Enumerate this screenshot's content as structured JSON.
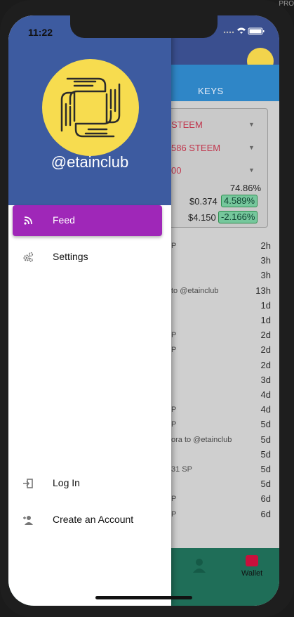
{
  "status": {
    "time": "11:22",
    "corner_text": "PRO"
  },
  "drawer": {
    "username": "@etainclub",
    "menu": [
      {
        "label": "Feed",
        "icon": "rss-icon",
        "active": true
      },
      {
        "label": "Settings",
        "icon": "gears-icon",
        "active": false
      }
    ],
    "bottom_menu": [
      {
        "label": "Log In",
        "icon": "login-icon"
      },
      {
        "label": "Create an Account",
        "icon": "add-user-icon"
      }
    ]
  },
  "background_app": {
    "tab_label": "KEYS",
    "dropdowns": [
      "STEEM",
      "586 STEEM",
      "00"
    ],
    "percent": "74.86%",
    "price1": {
      "value": "$0.374",
      "change": "4.589%"
    },
    "price2": {
      "value": "$4.150",
      "change": "-2.166%"
    },
    "rows": [
      {
        "fragment": "P",
        "time": "2h"
      },
      {
        "fragment": "",
        "time": "3h"
      },
      {
        "fragment": "",
        "time": "3h"
      },
      {
        "fragment": "to @etainclub",
        "time": "13h"
      },
      {
        "fragment": "",
        "time": "1d"
      },
      {
        "fragment": "",
        "time": "1d"
      },
      {
        "fragment": "P",
        "time": "2d"
      },
      {
        "fragment": "P",
        "time": "2d"
      },
      {
        "fragment": "",
        "time": "2d"
      },
      {
        "fragment": "",
        "time": "3d"
      },
      {
        "fragment": "",
        "time": "4d"
      },
      {
        "fragment": "P",
        "time": "4d"
      },
      {
        "fragment": "P",
        "time": "5d"
      },
      {
        "fragment": "ora to @etainclub",
        "time": "5d"
      },
      {
        "fragment": "",
        "time": "5d"
      },
      {
        "fragment": "31 SP",
        "time": "5d"
      },
      {
        "fragment": "",
        "time": "5d"
      },
      {
        "fragment": "P",
        "time": "6d"
      },
      {
        "fragment": "P",
        "time": "6d"
      }
    ],
    "footer": {
      "wallet_label": "Wallet"
    }
  },
  "colors": {
    "drawer_header": "#3d5ba0",
    "active_item": "#9f27b8",
    "logo_yellow": "#f7dc4f",
    "up_chip": "#76c79c",
    "footer": "#1f6e58"
  }
}
